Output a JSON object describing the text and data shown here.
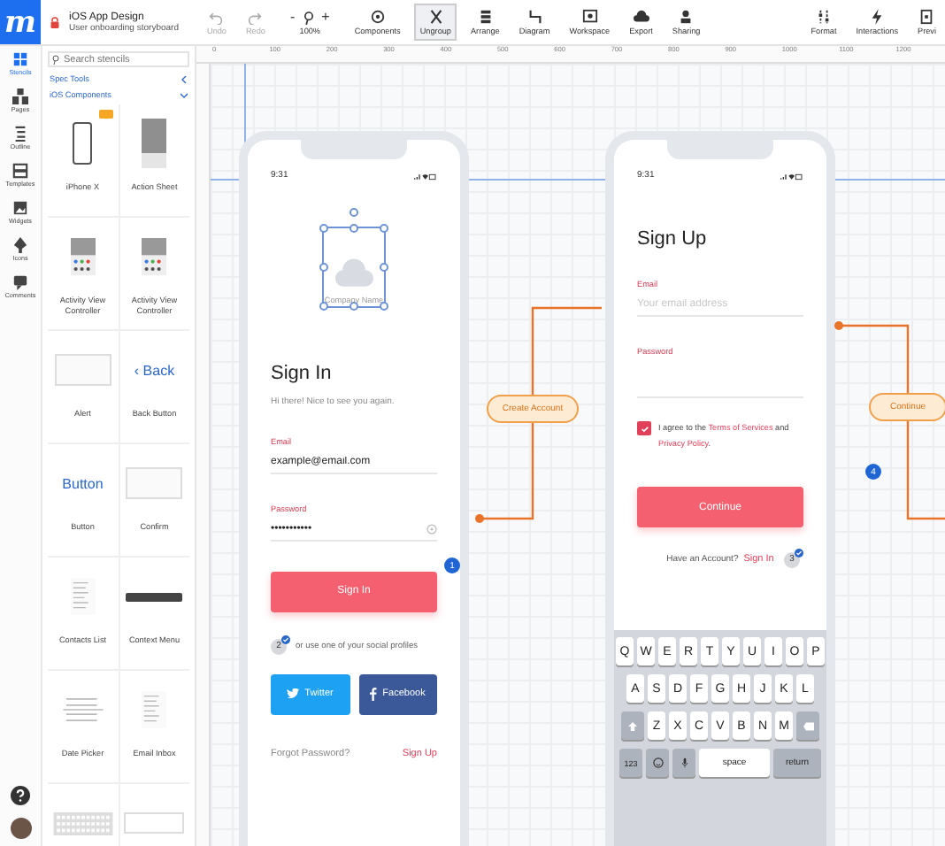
{
  "header": {
    "logo": "m",
    "title": "iOS App Design",
    "subtitle": "User onboarding storyboard"
  },
  "history": [
    {
      "label": "Undo",
      "kind": "undo",
      "disabled": true
    },
    {
      "label": "Redo",
      "kind": "redo",
      "disabled": true
    }
  ],
  "zoom": {
    "minus": "-",
    "plus": "+",
    "value": "100%"
  },
  "tools": [
    {
      "label": "Components",
      "kind": "components",
      "selected": false
    },
    {
      "label": "Ungroup",
      "kind": "ungroup",
      "selected": true
    },
    {
      "label": "Arrange",
      "kind": "arrange",
      "selected": false
    },
    {
      "label": "Diagram",
      "kind": "diagram",
      "selected": false
    },
    {
      "label": "Workspace",
      "kind": "workspace",
      "selected": false
    },
    {
      "label": "Export",
      "kind": "export",
      "selected": false
    },
    {
      "label": "Sharing",
      "kind": "sharing",
      "selected": false
    }
  ],
  "tools_right": [
    {
      "label": "Format",
      "kind": "format"
    },
    {
      "label": "Interactions",
      "kind": "interactions"
    },
    {
      "label": "Previ",
      "kind": "preview"
    }
  ],
  "rail": [
    {
      "label": "Stencils",
      "kind": "stencils",
      "selected": true
    },
    {
      "label": "Pages",
      "kind": "pages",
      "selected": false
    },
    {
      "label": "Outline",
      "kind": "outline",
      "selected": false
    },
    {
      "label": "Templates",
      "kind": "templates",
      "selected": false
    },
    {
      "label": "Widgets",
      "kind": "widgets",
      "selected": false
    },
    {
      "label": "Icons",
      "kind": "icons",
      "selected": false
    },
    {
      "label": "Comments",
      "kind": "comments",
      "selected": false
    }
  ],
  "stencils": {
    "placeholder": "Search stencils",
    "sections": [
      {
        "label": "Spec Tools",
        "expanded": false
      },
      {
        "label": "iOS Components",
        "expanded": true
      }
    ],
    "rows": [
      [
        {
          "label": "iPhone X",
          "kind": "phone",
          "badge": true
        },
        {
          "label": "Action Sheet",
          "kind": "sheet",
          "badge": false
        }
      ],
      [
        {
          "label": "Activity View Controller",
          "kind": "activity",
          "badge": false
        },
        {
          "label": "Activity View Controller",
          "kind": "activity",
          "badge": false
        }
      ],
      [
        {
          "label": "Alert",
          "kind": "alert",
          "badge": false
        },
        {
          "label": "Back Button",
          "kind": "back",
          "preview": "‹ Back",
          "badge": false
        }
      ],
      [
        {
          "label": "Button",
          "kind": "button",
          "preview": "Button",
          "badge": false
        },
        {
          "label": "Confirm",
          "kind": "confirm",
          "badge": false
        }
      ],
      [
        {
          "label": "Contacts List",
          "kind": "list",
          "badge": false
        },
        {
          "label": "Context Menu",
          "kind": "menu",
          "badge": false
        }
      ],
      [
        {
          "label": "Date Picker",
          "kind": "picker",
          "badge": false
        },
        {
          "label": "Email Inbox",
          "kind": "list",
          "badge": false
        }
      ],
      [
        {
          "kind": "keyboard",
          "badge": false
        },
        {
          "kind": "notification",
          "badge": false
        }
      ]
    ]
  },
  "ruler": [
    "0",
    "100",
    "200",
    "300",
    "400",
    "500",
    "600",
    "700",
    "800",
    "900",
    "1000",
    "1100",
    "1200"
  ],
  "sign_in": {
    "time": "9:31",
    "company": "Company Name",
    "title": "Sign In",
    "subtitle": "Hi there! Nice to see you again.",
    "email_label": "Email",
    "email_value": "example@email.com",
    "password_label": "Password",
    "password_value": "•••••••••••",
    "button": "Sign In",
    "button_badge": "1",
    "social_badge": "2",
    "social_text": "or use one of your social profiles",
    "twitter": "Twitter",
    "facebook": "Facebook",
    "forgot": "Forgot Password?",
    "signup": "Sign Up"
  },
  "sign_up": {
    "time": "9:31",
    "title": "Sign Up",
    "email_label": "Email",
    "email_placeholder": "Your email address",
    "password_label": "Password",
    "agree_checked": true,
    "agree": [
      {
        "text": "I agree to the ",
        "kind": "plain"
      },
      {
        "text": "Terms of Services",
        "kind": "link"
      },
      {
        "text": " and ",
        "kind": "plain"
      },
      {
        "text": "Privacy Policy",
        "kind": "link"
      },
      {
        "text": ".",
        "kind": "plain"
      }
    ],
    "button": "Continue",
    "have_account": "Have an Account?",
    "signin": "Sign In",
    "badge": "3"
  },
  "keyboard": {
    "rows": [
      [
        "Q",
        "W",
        "E",
        "R",
        "T",
        "Y",
        "U",
        "I",
        "O",
        "P"
      ],
      [
        "A",
        "S",
        "D",
        "F",
        "G",
        "H",
        "J",
        "K",
        "L"
      ],
      [
        "Z",
        "X",
        "C",
        "V",
        "B",
        "N",
        "M"
      ]
    ],
    "number_key": "123",
    "space_key": "space",
    "return_key": "return"
  },
  "flows": [
    {
      "label": "Create Account"
    },
    {
      "label": "Continue"
    }
  ],
  "step_badge": "4"
}
